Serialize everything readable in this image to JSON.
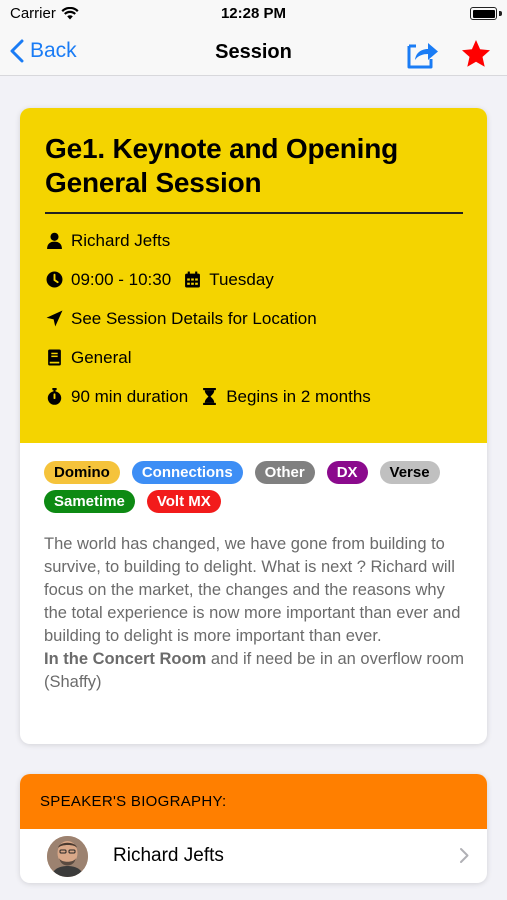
{
  "status": {
    "carrier": "Carrier",
    "time": "12:28 PM",
    "battery_level": 1.0
  },
  "nav": {
    "back_label": "Back",
    "title": "Session",
    "icons": [
      "share-icon",
      "star-icon"
    ],
    "star_color": "#ff0000",
    "accent": "#1a7cf5"
  },
  "session": {
    "title_line1": "Ge1. Keynote and Opening",
    "title_line2": "General Session",
    "speaker": "Richard Jefts",
    "time": "09:00 - 10:30",
    "day": "Tuesday",
    "location": "See Session Details for Location",
    "track": "General",
    "duration": "90 min duration",
    "begins": "Begins in 2 months",
    "header_color": "#f4d400"
  },
  "tags": [
    {
      "label": "Domino",
      "color": "#f5c33b"
    },
    {
      "label": "Connections",
      "color": "#3d8ef5"
    },
    {
      "label": "Other",
      "color": "#808080"
    },
    {
      "label": "DX",
      "color": "#8b0a8d"
    },
    {
      "label": "Verse",
      "color": "#c0c0c0"
    },
    {
      "label": "Sametime",
      "color": "#0d8a13"
    },
    {
      "label": "Volt MX",
      "color": "#f21b1b"
    }
  ],
  "description": {
    "text": "The world has changed, we have gone from building to survive, to building to delight. What is next ? Richard will focus on the market, the changes and the reasons why the total experience is now more important than ever and building to delight is more important than ever.",
    "room_bold": "In the Concert Room",
    "room_rest": " and if need be in an overflow room (Shaffy)"
  },
  "biography": {
    "header": "SPEAKER'S BIOGRAPHY:",
    "name": "Richard Jefts",
    "header_color": "#ff7f00"
  }
}
